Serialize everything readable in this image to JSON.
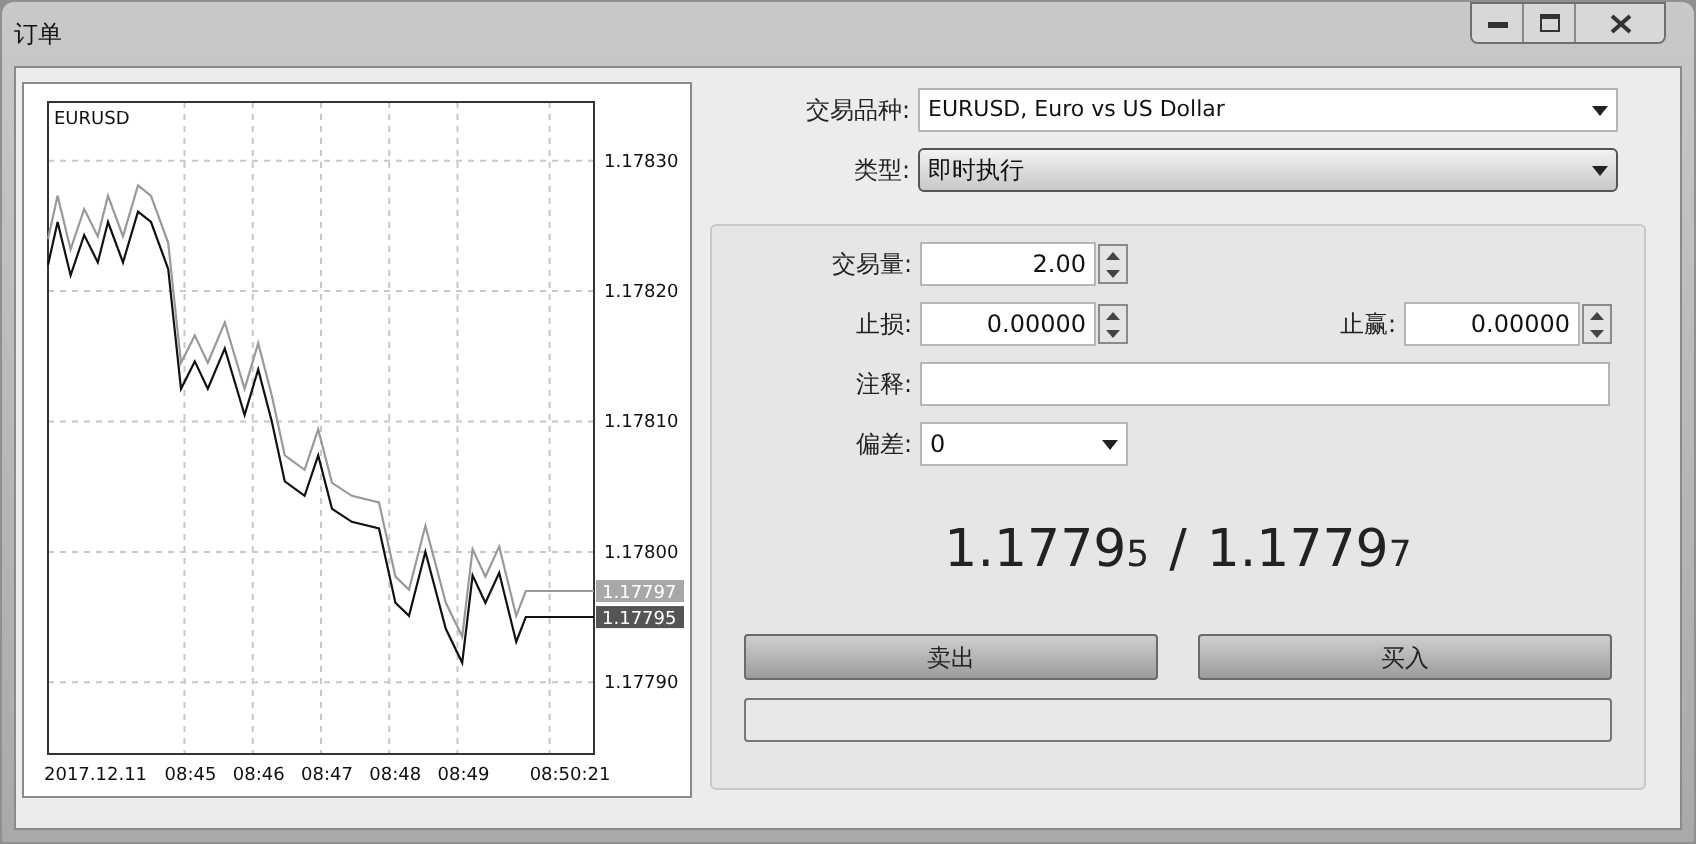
{
  "window": {
    "title": "订单"
  },
  "chart": {
    "chart_data": {
      "type": "line",
      "title": "EURUSD",
      "grid": true,
      "x": [
        523,
        523.14,
        523.33,
        523.53,
        523.73,
        523.88,
        524.1,
        524.32,
        524.51,
        524.76,
        524.95,
        525.15,
        525.34,
        525.59,
        525.88,
        526.08,
        526.28,
        526.47,
        526.76,
        526.96,
        527.16,
        527.45,
        527.85,
        528.09,
        528.29,
        528.53,
        528.83,
        529.07,
        529.22,
        529.41,
        529.61,
        529.86,
        530.0,
        531.0
      ],
      "series": [
        {
          "color": "#111111",
          "values": [
            1.17822,
            1.178253,
            1.178212,
            1.178243,
            1.178222,
            1.178253,
            1.178222,
            1.178261,
            1.178253,
            1.178217,
            1.178125,
            1.178146,
            1.178125,
            1.178156,
            1.178105,
            1.17814,
            1.1781,
            1.178054,
            1.178043,
            1.178074,
            1.178033,
            1.178023,
            1.178018,
            1.177961,
            1.177951,
            1.178,
            1.177941,
            1.177915,
            1.177982,
            1.177961,
            1.177984,
            1.177931,
            1.17795,
            1.17795
          ]
        },
        {
          "color": "#999999",
          "values": [
            1.17824,
            1.178273,
            1.178232,
            1.178263,
            1.178242,
            1.178273,
            1.178242,
            1.178281,
            1.178273,
            1.178237,
            1.178145,
            1.178166,
            1.178145,
            1.178176,
            1.178125,
            1.17816,
            1.17812,
            1.178074,
            1.178063,
            1.178094,
            1.178053,
            1.178043,
            1.178038,
            1.177981,
            1.177971,
            1.17802,
            1.177961,
            1.177935,
            1.178002,
            1.177981,
            1.178004,
            1.177951,
            1.17797,
            1.17797
          ]
        }
      ],
      "xlim": [
        523,
        531
      ],
      "ylim": [
        1.177845,
        1.178345
      ],
      "xticks": [
        {
          "value": 523,
          "label": "2017.12.11"
        },
        {
          "value": 525,
          "label": "08:45"
        },
        {
          "value": 526,
          "label": "08:46"
        },
        {
          "value": 527,
          "label": "08:47"
        },
        {
          "value": 528,
          "label": "08:48"
        },
        {
          "value": 529,
          "label": "08:49"
        },
        {
          "value": 530.35,
          "label": "08:50:21"
        }
      ],
      "yticks": [
        {
          "value": 1.1783,
          "label": "1.17830"
        },
        {
          "value": 1.1782,
          "label": "1.17820"
        },
        {
          "value": 1.1781,
          "label": "1.17810"
        },
        {
          "value": 1.178,
          "label": "1.17800"
        },
        {
          "value": 1.1779,
          "label": "1.17790"
        }
      ]
    },
    "price_tags": [
      {
        "text": "1.17797",
        "kind": "ask"
      },
      {
        "text": "1.17795",
        "kind": "bid"
      }
    ]
  },
  "symbol": {
    "label": "交易品种:",
    "value": "EURUSD, Euro vs US Dollar"
  },
  "order_type": {
    "label": "类型:",
    "value": "即时执行"
  },
  "volume": {
    "label": "交易量:",
    "value": "2.00"
  },
  "stop_loss": {
    "label": "止损:",
    "value": "0.00000"
  },
  "take_profit": {
    "label": "止赢:",
    "value": "0.00000"
  },
  "comment": {
    "label": "注释:"
  },
  "deviation": {
    "label": "偏差:",
    "value": "0"
  },
  "quote": {
    "bid": {
      "main": "1.1779",
      "last": "5"
    },
    "separator": "/",
    "ask": {
      "main": "1.1779",
      "last": "7"
    }
  },
  "buttons": [
    {
      "label": "卖出"
    },
    {
      "label": "买入"
    }
  ]
}
